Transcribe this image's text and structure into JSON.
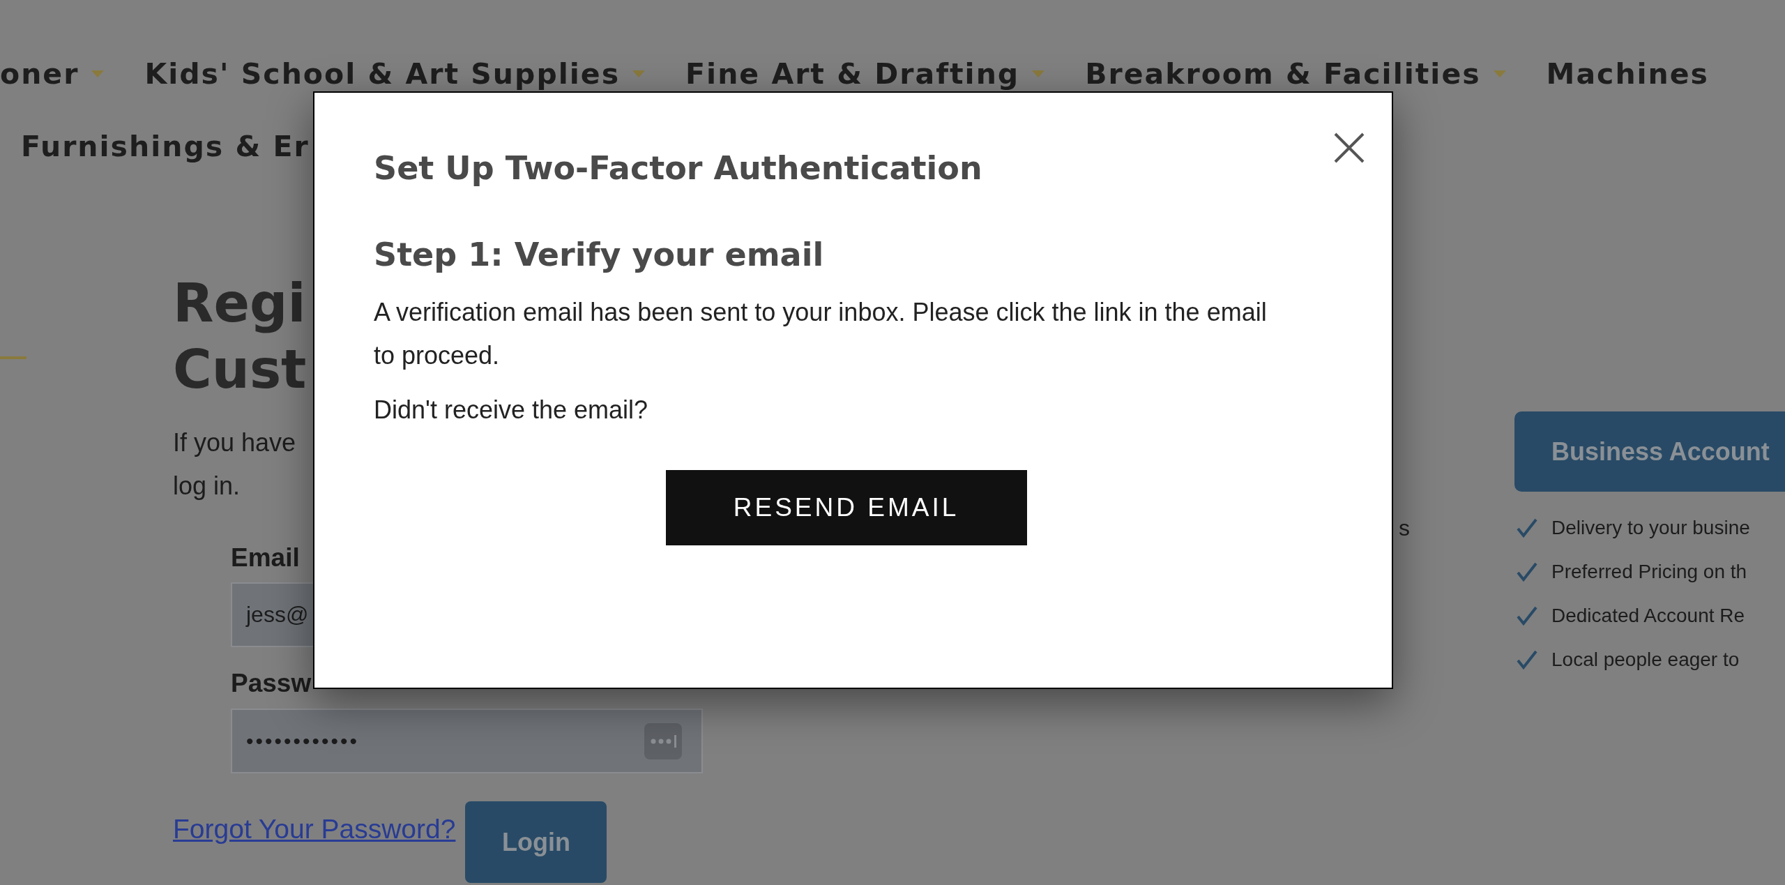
{
  "nav": {
    "rows": [
      [
        {
          "label": "oner",
          "dropdown": true
        },
        {
          "label": "Kids' School & Art Supplies",
          "dropdown": true
        },
        {
          "label": "Fine Art & Drafting",
          "dropdown": true
        },
        {
          "label": "Breakroom & Facilities",
          "dropdown": true
        },
        {
          "label": "Machines",
          "dropdown": false
        }
      ],
      [
        {
          "label": "Furnishings & Er",
          "dropdown": false
        }
      ]
    ]
  },
  "login": {
    "heading_lines": [
      "Regi",
      "Cust"
    ],
    "intro_lines": [
      "If you have",
      "log in."
    ],
    "email_label": "Email",
    "email_value": "jess@",
    "password_label": "Passw",
    "password_value": "••••••••••••",
    "forgot_link": "Forgot Your Password?",
    "login_button": "Login"
  },
  "middle": {
    "fragment": "s"
  },
  "business": {
    "button": "Business Account",
    "benefits": [
      "Delivery to your busine",
      "Preferred Pricing on th",
      "Dedicated Account Re",
      "Local people eager to"
    ]
  },
  "modal": {
    "title": "Set Up Two-Factor Authentication",
    "step_heading": "Step 1: Verify your email",
    "message": "A verification email has been sent to your inbox. Please click the link in the email to proceed.",
    "question": "Didn't receive the email?",
    "button": "RESEND EMAIL"
  }
}
